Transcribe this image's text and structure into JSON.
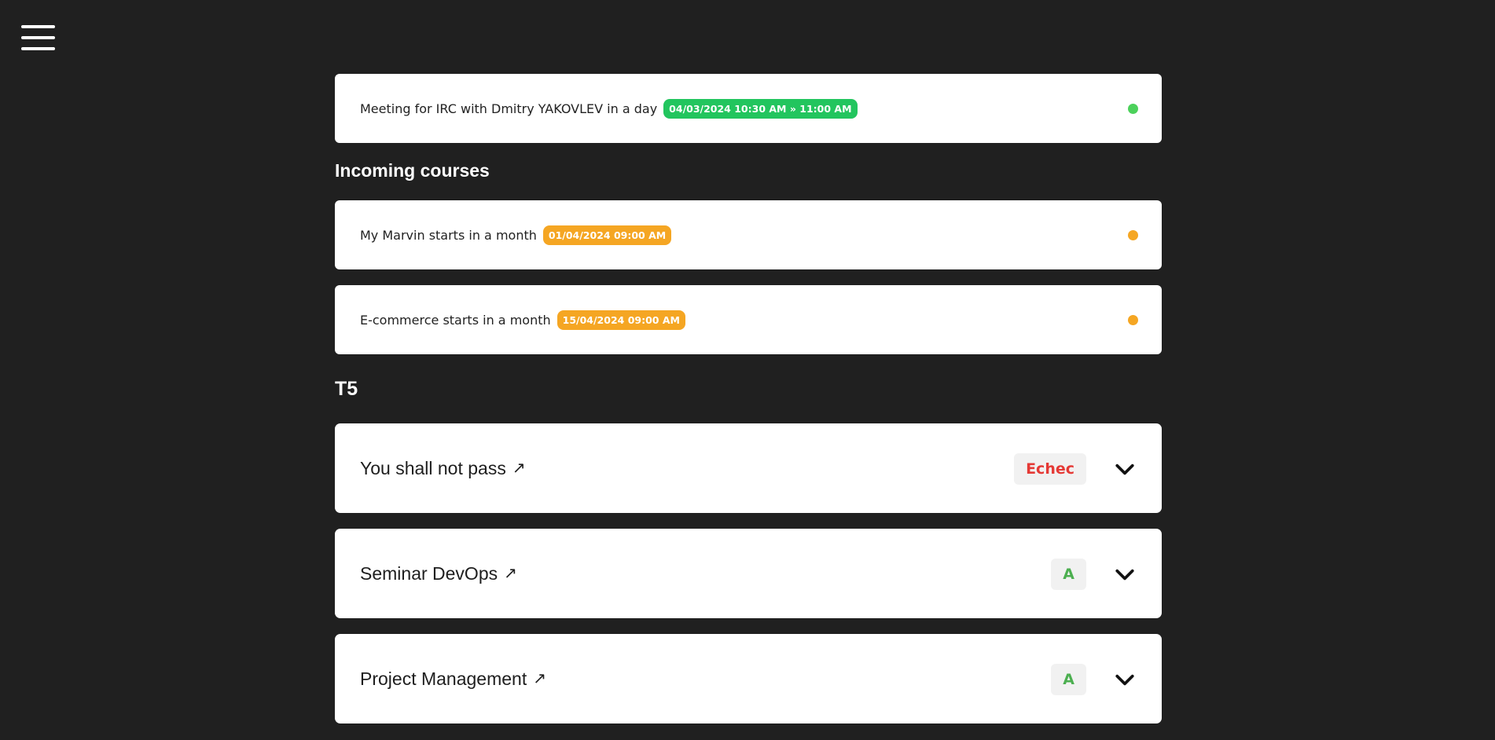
{
  "menu": {
    "icon": "hamburger-menu-icon"
  },
  "upcoming_event": {
    "text": "Meeting for IRC with Dmitry YAKOVLEV in a day",
    "badge": "04/03/2024 10:30 AM » 11:00 AM",
    "color": "#22c55e",
    "dot_color": "#4cd15b"
  },
  "incoming_courses": {
    "title": "Incoming courses",
    "items": [
      {
        "text": "My Marvin starts in a month",
        "badge": "01/04/2024 09:00 AM",
        "color": "#f5a623"
      },
      {
        "text": "E-commerce starts in a month",
        "badge": "15/04/2024 09:00 AM",
        "color": "#f5a623"
      }
    ]
  },
  "t5": {
    "title": "T5",
    "modules": [
      {
        "title": "You shall not pass",
        "grade": "Echec",
        "grade_color": "#e53935"
      },
      {
        "title": "Seminar DevOps",
        "grade": "A",
        "grade_color": "#4caf50"
      },
      {
        "title": "Project Management",
        "grade": "A",
        "grade_color": "#4caf50"
      }
    ]
  },
  "icons": {
    "external_link": "external-link-icon",
    "expand": "chevron-down-icon"
  }
}
